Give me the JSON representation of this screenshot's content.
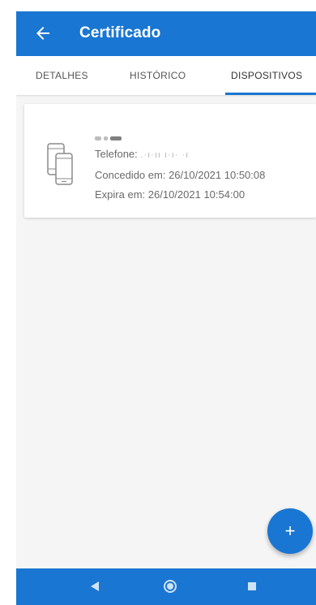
{
  "appbar": {
    "title": "Certificado",
    "back_icon": "arrow-left-icon"
  },
  "tabs": [
    {
      "label": "DETALHES",
      "active": false
    },
    {
      "label": "HISTÓRICO",
      "active": false
    },
    {
      "label": "DISPOSITIVOS",
      "active": true
    }
  ],
  "device_card": {
    "icon": "mobile-devices-icon",
    "name_masked": "·· ··",
    "phone_label": "Telefone:",
    "phone_value_masked": "  .·ı·ıı ı·ı·   ·ı",
    "granted_label": "Concedido em:",
    "granted_value": "26/10/2021 10:50:08",
    "expires_label": "Expira em:",
    "expires_value": "26/10/2021 10:54:00"
  },
  "fab": {
    "label": "+",
    "icon": "plus-icon"
  },
  "system_nav": {
    "back_icon": "triangle-back-icon",
    "home_icon": "circle-home-icon",
    "recents_icon": "square-recents-icon"
  },
  "colors": {
    "primary": "#1976d2",
    "background": "#f5f5f5",
    "card": "#ffffff"
  }
}
